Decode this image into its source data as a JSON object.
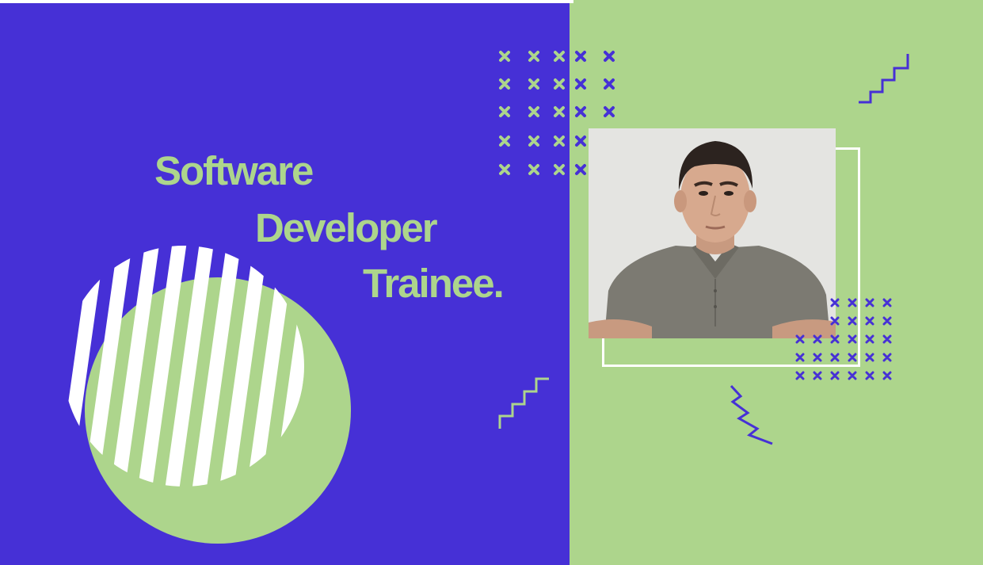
{
  "title": {
    "line1": "Software",
    "line2": "Developer",
    "line3": "Trainee."
  },
  "colors": {
    "purple": "#4630d6",
    "green": "#add58c",
    "white": "#ffffff"
  },
  "icons": {
    "cross_pattern": "cross-icon",
    "zigzag": "zigzag-icon",
    "stripes": "striped-circle"
  }
}
